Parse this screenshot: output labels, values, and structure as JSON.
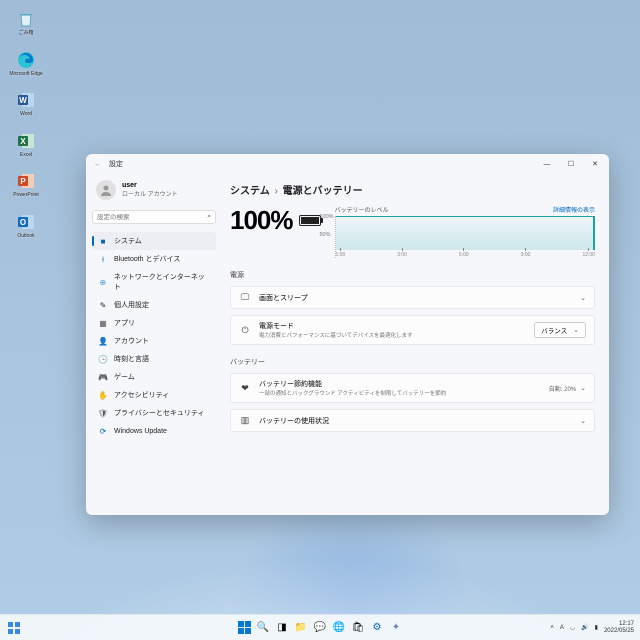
{
  "desktop_icons": [
    {
      "name": "recycle-bin",
      "label": "ごみ箱"
    },
    {
      "name": "edge",
      "label": "Microsoft Edge"
    },
    {
      "name": "word",
      "label": "Word"
    },
    {
      "name": "excel",
      "label": "Excel"
    },
    {
      "name": "powerpoint",
      "label": "PowerPoint"
    },
    {
      "name": "outlook",
      "label": "Outlook"
    }
  ],
  "window": {
    "title": "設定",
    "user": {
      "name": "user",
      "account": "ローカル アカウント"
    },
    "search_placeholder": "設定の検索",
    "nav": [
      {
        "icon": "■",
        "color": "#0067c0",
        "label": "システム",
        "sel": true
      },
      {
        "icon": "ᚼ",
        "color": "#0067c0",
        "label": "Bluetooth とデバイス"
      },
      {
        "icon": "⊕",
        "color": "#4b9bd8",
        "label": "ネットワークとインターネット"
      },
      {
        "icon": "✎",
        "color": "#2a2a2a",
        "label": "個人用設定"
      },
      {
        "icon": "▦",
        "color": "#555",
        "label": "アプリ"
      },
      {
        "icon": "👤",
        "color": "#555",
        "label": "アカウント"
      },
      {
        "icon": "🕒",
        "color": "#555",
        "label": "時刻と言語"
      },
      {
        "icon": "🎮",
        "color": "#555",
        "label": "ゲーム"
      },
      {
        "icon": "✋",
        "color": "#3a88c8",
        "label": "アクセシビリティ"
      },
      {
        "icon": "🛡",
        "color": "#555",
        "label": "プライバシーとセキュリティ"
      },
      {
        "icon": "⟳",
        "color": "#0067c0",
        "label": "Windows Update"
      }
    ],
    "breadcrumb": {
      "a": "システム",
      "b": "電源とバッテリー"
    },
    "battery": {
      "percent": "100%",
      "level_label": "バッテリーのレベル",
      "detail_link": "詳細情報の表示"
    },
    "sections": {
      "power": "電源",
      "battery": "バッテリー"
    },
    "cards": {
      "sleep": {
        "title": "画面とスリープ"
      },
      "mode": {
        "title": "電源モード",
        "desc": "電力消費とパフォーマンスに基づいてデバイスを最適化します",
        "value": "バランス"
      },
      "saver": {
        "title": "バッテリー節約機能",
        "desc": "一部の通知とバックグラウンド アクティビティを制限してバッテリーを節約",
        "status": "自動: 20%"
      },
      "usage": {
        "title": "バッテリーの使用状況"
      }
    }
  },
  "chart_data": {
    "type": "area",
    "title": "バッテリーのレベル",
    "xlabel": "",
    "ylabel": "",
    "ylim": [
      0,
      100
    ],
    "yticks": [
      "100%",
      "50%"
    ],
    "xticks": [
      "1:00",
      "3:00",
      "6:00",
      "9:00",
      "12:00"
    ],
    "x": [
      1,
      2,
      3,
      4,
      5,
      6,
      7,
      8,
      9,
      10,
      11,
      12
    ],
    "values": [
      100,
      100,
      100,
      100,
      100,
      100,
      100,
      100,
      100,
      100,
      100,
      100
    ]
  },
  "taskbar": {
    "time": "12:17",
    "date": "2022/05/25",
    "tray_icons": [
      "chevron-up-icon",
      "onedrive-icon",
      "sound-icon",
      "wifi-icon",
      "battery-icon",
      "ime-icon"
    ]
  }
}
